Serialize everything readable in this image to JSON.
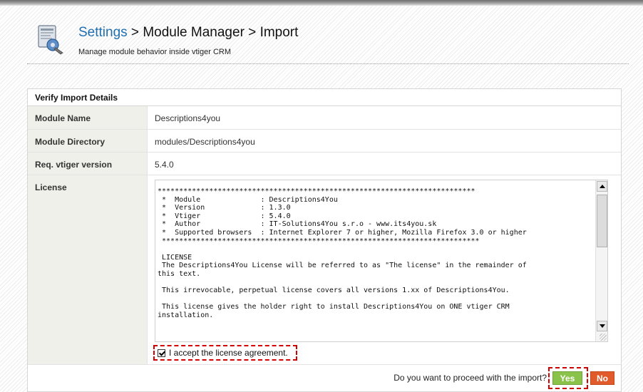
{
  "header": {
    "breadcrumb_settings": "Settings",
    "breadcrumb_sep1": " > ",
    "breadcrumb_module_manager": "Module Manager",
    "breadcrumb_sep2": " > ",
    "breadcrumb_import": "Import",
    "subtitle": "Manage module behavior inside vtiger CRM",
    "icon": "settings-tools-icon"
  },
  "panel": {
    "title": "Verify Import Details",
    "rows": [
      {
        "label": "Module Name",
        "value": "Descriptions4you"
      },
      {
        "label": "Module Directory",
        "value": "modules/Descriptions4you"
      },
      {
        "label": "Req. vtiger version",
        "value": "5.4.0"
      },
      {
        "label": "License",
        "value": ""
      }
    ],
    "license_text": "**************************************************************************\n *  Module              : Descriptions4You\n *  Version             : 1.3.0\n *  Vtiger              : 5.4.0\n *  Author              : IT-Solutions4You s.r.o - www.its4you.sk\n *  Supported browsers  : Internet Explorer 7 or higher, Mozilla Firefox 3.0 or higher\n **************************************************************************\n\n LICENSE\n The Descriptions4You License will be referred to as \"The license\" in the remainder of\nthis text.\n\n This irrevocable, perpetual license covers all versions 1.xx of Descriptions4You.\n\n This license gives the holder right to install Descriptions4You on ONE vtiger CRM\ninstallation.",
    "accept_label": "I accept the license agreement.",
    "accept_checked": true
  },
  "footer": {
    "question": "Do you want to proceed with the import?",
    "yes_label": "Yes",
    "no_label": "No"
  },
  "colors": {
    "link": "#1f6fb0",
    "yes_button": "#8bc34a",
    "no_button": "#e05a2b",
    "highlight": "#d40000"
  }
}
